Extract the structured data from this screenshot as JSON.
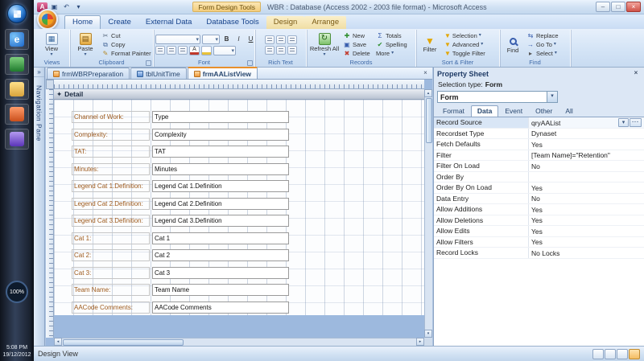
{
  "colors": {
    "accent_orange": "#e8902c",
    "chrome_blue": "#c7dbf3",
    "canvas_blue": "#9db9de",
    "label_brown": "#9e5a1c"
  },
  "taskbar": {
    "zoom": "100%",
    "time": "5:08 PM",
    "date": "19/12/2012"
  },
  "titlebar": {
    "contextual": "Form Design Tools",
    "title": "WBR : Database (Access 2002 - 2003 file format) - Microsoft Access"
  },
  "ribbon": {
    "tabs": [
      {
        "label": "Home",
        "active": true
      },
      {
        "label": "Create"
      },
      {
        "label": "External Data"
      },
      {
        "label": "Database Tools"
      },
      {
        "label": "Design",
        "contextual": true
      },
      {
        "label": "Arrange",
        "contextual": true
      }
    ],
    "views": {
      "label": "Views",
      "view_button": "View"
    },
    "clipboard": {
      "label": "Clipboard",
      "paste": "Paste",
      "cut": "Cut",
      "copy": "Copy",
      "format_painter": "Format Painter"
    },
    "font": {
      "label": "Font"
    },
    "rich_text": {
      "label": "Rich Text"
    },
    "records": {
      "label": "Records",
      "refresh": "Refresh All",
      "new": "New",
      "save": "Save",
      "delete": "Delete",
      "totals": "Totals",
      "spelling": "Spelling",
      "more": "More"
    },
    "sort_filter": {
      "label": "Sort & Filter",
      "filter": "Filter",
      "selection": "Selection",
      "advanced": "Advanced",
      "toggle": "Toggle Filter"
    },
    "find": {
      "label": "Find",
      "find": "Find",
      "replace": "Replace",
      "goto": "Go To",
      "select": "Select"
    }
  },
  "nav_pane": {
    "label": "Navigation Pane"
  },
  "doc_tabs": [
    {
      "label": "frmWBRPreparation",
      "type": "form",
      "active": false
    },
    {
      "label": "tblUnitTime",
      "type": "table",
      "active": false
    },
    {
      "label": "frmAAListView",
      "type": "form",
      "active": true
    }
  ],
  "design": {
    "section": "Detail",
    "rows": [
      {
        "label": "Channel of Work:",
        "value": "Type"
      },
      {
        "label": "Complexity:",
        "value": "Complexity"
      },
      {
        "label": "TAT:",
        "value": "TAT"
      },
      {
        "label": "Minutes:",
        "value": "Minutes"
      },
      {
        "label": "Legend Cat 1.Definition:",
        "value": "Legend Cat 1.Definition"
      },
      {
        "label": "Legend Cat 2.Definition:",
        "value": "Legend Cat 2.Definition"
      },
      {
        "label": "Legend Cat 3.Definition:",
        "value": "Legend Cat 3.Definition"
      },
      {
        "label": "Cat 1:",
        "value": "Cat 1"
      },
      {
        "label": "Cat 2:",
        "value": "Cat 2"
      },
      {
        "label": "Cat 3:",
        "value": "Cat 3"
      },
      {
        "label": "Team Name:",
        "value": "Team Name"
      },
      {
        "label": "AACode Comments:",
        "value": "AACode Comments"
      }
    ]
  },
  "property_sheet": {
    "title": "Property Sheet",
    "selection_label": "Selection type:",
    "selection_value": "Form",
    "selector": "Form",
    "tabs": [
      {
        "label": "Format"
      },
      {
        "label": "Data",
        "active": true
      },
      {
        "label": "Event"
      },
      {
        "label": "Other"
      },
      {
        "label": "All"
      }
    ],
    "properties": [
      {
        "name": "Record Source",
        "value": "qryAAList",
        "selected": true
      },
      {
        "name": "Recordset Type",
        "value": "Dynaset"
      },
      {
        "name": "Fetch Defaults",
        "value": "Yes"
      },
      {
        "name": "Filter",
        "value": "[Team Name]=\"Retention\""
      },
      {
        "name": "Filter On Load",
        "value": "No"
      },
      {
        "name": "Order By",
        "value": ""
      },
      {
        "name": "Order By On Load",
        "value": "Yes"
      },
      {
        "name": "Data Entry",
        "value": "No"
      },
      {
        "name": "Allow Additions",
        "value": "Yes"
      },
      {
        "name": "Allow Deletions",
        "value": "Yes"
      },
      {
        "name": "Allow Edits",
        "value": "Yes"
      },
      {
        "name": "Allow Filters",
        "value": "Yes"
      },
      {
        "name": "Record Locks",
        "value": "No Locks"
      }
    ]
  },
  "status": {
    "view": "Design View"
  },
  "icons": {
    "dropdown": "▾",
    "close": "×",
    "minimize": "–",
    "maximize": "□",
    "undo": "↶",
    "access_a": "A",
    "save_disk": "▣",
    "view_sheet": "▦",
    "paste_sheet": "▤",
    "cut": "✂",
    "copy": "⧉",
    "format_painter": "✎",
    "refresh": "↻",
    "new_plus": "✚",
    "delete_x": "✖",
    "totals_sigma": "Σ",
    "spelling_check": "✔",
    "funnel": "▼",
    "replace_arrows": "⇆",
    "goto_arrow": "→",
    "select_cursor": "▸",
    "bold": "B",
    "italic": "I",
    "underline": "U",
    "font_a": "A",
    "nav_expand": "»",
    "detail_marker": "✦",
    "builder": "...",
    "scroll_up": "▴",
    "scroll_down": "▾",
    "scroll_left": "◂",
    "scroll_right": "▸",
    "ie_e": "e"
  }
}
